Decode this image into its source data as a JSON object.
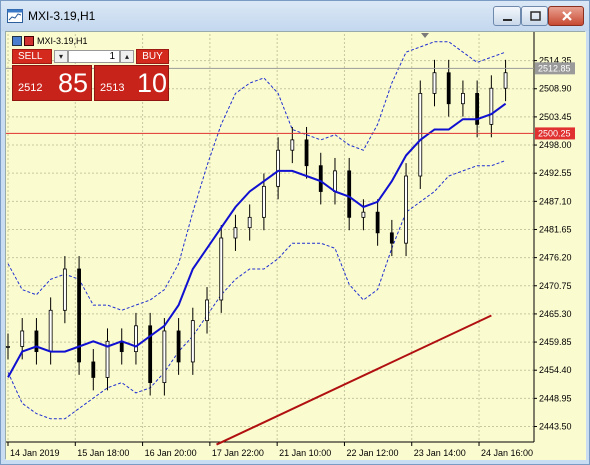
{
  "window": {
    "title": "MXI-3.19,H1"
  },
  "trade_panel": {
    "symbol_label": "MXI-3.19,H1",
    "sell_label": "SELL",
    "buy_label": "BUY",
    "lot_value": "1",
    "lot_down_glyph": "▾",
    "lot_up_glyph": "▴",
    "sell_price_prefix": "2512",
    "sell_price_big": "85",
    "buy_price_prefix": "2513",
    "buy_price_big": "10"
  },
  "price_axis": {
    "labels": [
      "2514.35",
      "2508.90",
      "2503.45",
      "2498.00",
      "2492.55",
      "2487.10",
      "2481.65",
      "2476.20",
      "2470.75",
      "2465.30",
      "2459.85",
      "2454.40",
      "2448.95",
      "2443.50"
    ],
    "current_price_tag": "2512.85",
    "line_tag": "2500.25"
  },
  "time_axis": {
    "labels": [
      "14 Jan 2019",
      "15 Jan 18:00",
      "16 Jan 20:00",
      "17 Jan 22:00",
      "21 Jan 10:00",
      "22 Jan 12:00",
      "23 Jan 14:00",
      "24 Jan 16:00"
    ]
  },
  "colors": {
    "chart_bg": "#fbfbd0",
    "grid": "#c8c8a0",
    "candles": "#000000",
    "ma_fast": "#1010d0",
    "ma_slow": "#b01010",
    "bands": "#2030d0",
    "hline": "#e03030",
    "trade_red": "#d42a1e"
  },
  "chart_data": {
    "type": "candlestick",
    "ylim": [
      2440.5,
      2519.5
    ],
    "x": [
      0,
      3,
      6,
      9,
      12,
      15,
      18,
      21,
      24,
      27,
      30,
      33,
      36,
      39,
      42,
      45,
      48,
      51,
      54,
      57,
      60,
      63,
      66,
      69,
      72,
      75,
      78,
      81,
      84,
      87,
      90,
      93,
      96,
      99,
      102,
      105
    ],
    "close": [
      2459,
      2462,
      2458,
      2466,
      2474,
      2456,
      2453,
      2460,
      2458,
      2463,
      2452,
      2462,
      2456,
      2464,
      2468,
      2480,
      2482,
      2484,
      2490,
      2497,
      2499,
      2494,
      2489,
      2493,
      2484,
      2485,
      2481,
      2479,
      2492,
      2508,
      2512,
      2506,
      2508,
      2502,
      2509,
      2512
    ],
    "ma_fast": [
      2453,
      2458,
      2459,
      2458,
      2458,
      2459,
      2460,
      2459,
      2460,
      2459,
      2461,
      2463,
      2467,
      2474,
      2478,
      2482,
      2486,
      2489,
      2491,
      2493,
      2493,
      2492,
      2491,
      2489,
      2488,
      2486,
      2487,
      2491,
      2496,
      2499,
      2501,
      2501,
      2503,
      2503,
      2504,
      2506
    ],
    "upper_band": [
      2475,
      2470,
      2469,
      2472,
      2473,
      2472,
      2467,
      2467,
      2466,
      2467,
      2468,
      2470,
      2475,
      2485,
      2494,
      2502,
      2508,
      2510,
      2511,
      2508,
      2501,
      2500,
      2499,
      2500,
      2498,
      2497,
      2502,
      2510,
      2516,
      2517,
      2518,
      2518,
      2516,
      2514,
      2515,
      2516
    ],
    "lower_band": [
      2454,
      2448,
      2446,
      2445,
      2445,
      2447,
      2449,
      2451,
      2452,
      2450,
      2451,
      2454,
      2458,
      2461,
      2465,
      2469,
      2472,
      2474,
      2474,
      2476,
      2479,
      2479,
      2479,
      2478,
      2471,
      2468,
      2470,
      2478,
      2485,
      2487,
      2489,
      2492,
      2493,
      2494,
      2494,
      2495
    ],
    "ma_slow_start": [
      44,
      2440
    ],
    "ma_slow_end": [
      102,
      2465
    ],
    "horizontal_line": 2500.25,
    "current_price": 2512.85
  }
}
